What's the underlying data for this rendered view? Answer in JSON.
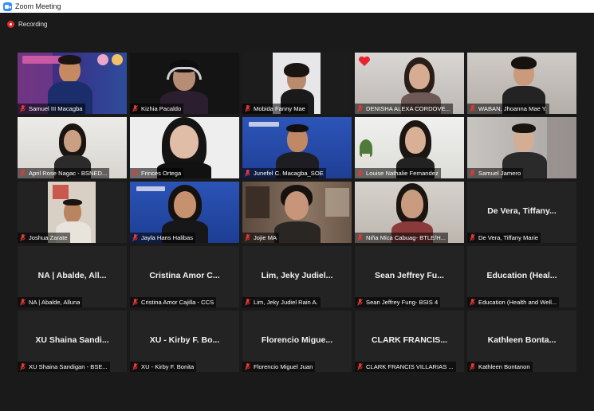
{
  "window": {
    "title": "Zoom Meeting"
  },
  "recording": {
    "label": "Recording"
  },
  "colors": {
    "recording_red": "#e02828",
    "muted_mic": "#e53935",
    "tile_bg": "#232323",
    "window_bg": "#1a1a1a"
  },
  "icons": {
    "mic": "mic-muted-icon",
    "app": "zoom-app-icon",
    "recording": "recording-dot-icon",
    "reaction": "heart-icon"
  },
  "tiles": [
    {
      "name": "Samuel III Macagba",
      "video": true
    },
    {
      "name": "Kizhia Pacaldo",
      "video": true
    },
    {
      "name": "Mobida Fanny Mae",
      "video": true
    },
    {
      "name": "DENISHA ALEXA CORDOVE...",
      "video": true,
      "reaction": "heart"
    },
    {
      "name": "WABAN, Jhoanna Mae Y.",
      "video": true
    },
    {
      "name": "April Rose Nagac - BSNED...",
      "video": true
    },
    {
      "name": "Frinces Ortega",
      "video": true
    },
    {
      "name": "Junefel C. Macagba_SOE",
      "video": true
    },
    {
      "name": "Louise Nathalie Fernandez",
      "video": true
    },
    {
      "name": "Samuel Jamero",
      "video": true
    },
    {
      "name": "Joshua Zarate",
      "video": true
    },
    {
      "name": "Jayla Hans Halibas",
      "video": true
    },
    {
      "name": "Jojie MA",
      "video": true
    },
    {
      "name": "Niña Mica Cabuag- BTLE/H...",
      "video": true
    },
    {
      "name": "De Vera, Tiffany Marie",
      "video": false,
      "display": "De Vera, Tiffany..."
    },
    {
      "name": "NA | Abalde, Alluna",
      "video": false,
      "display": "NA | Abalde, All..."
    },
    {
      "name": "Cristina Amor Cajilla - CCS",
      "video": false,
      "display": "Cristina Amor C..."
    },
    {
      "name": "Lim, Jeky Judiel Rain A.",
      "video": false,
      "display": "Lim, Jeky Judiel..."
    },
    {
      "name": "Sean Jeffrey Fung- BSIS 4",
      "video": false,
      "display": "Sean Jeffrey Fu..."
    },
    {
      "name": "Education (Health and Well...",
      "video": false,
      "display": "Education (Heal..."
    },
    {
      "name": "XU Shaina Sandigan - BSE...",
      "video": false,
      "display": "XU Shaina Sandi..."
    },
    {
      "name": "XU - Kirby F. Bonita",
      "video": false,
      "display": "XU - Kirby F. Bo..."
    },
    {
      "name": "Florencio Miguel Juan",
      "video": false,
      "display": "Florencio Migue..."
    },
    {
      "name": "CLARK FRANCIS VILLARIAS ...",
      "video": false,
      "display": "CLARK FRANCIS..."
    },
    {
      "name": "Kathleen Bontanon",
      "video": false,
      "display": "Kathleen Bonta..."
    }
  ]
}
